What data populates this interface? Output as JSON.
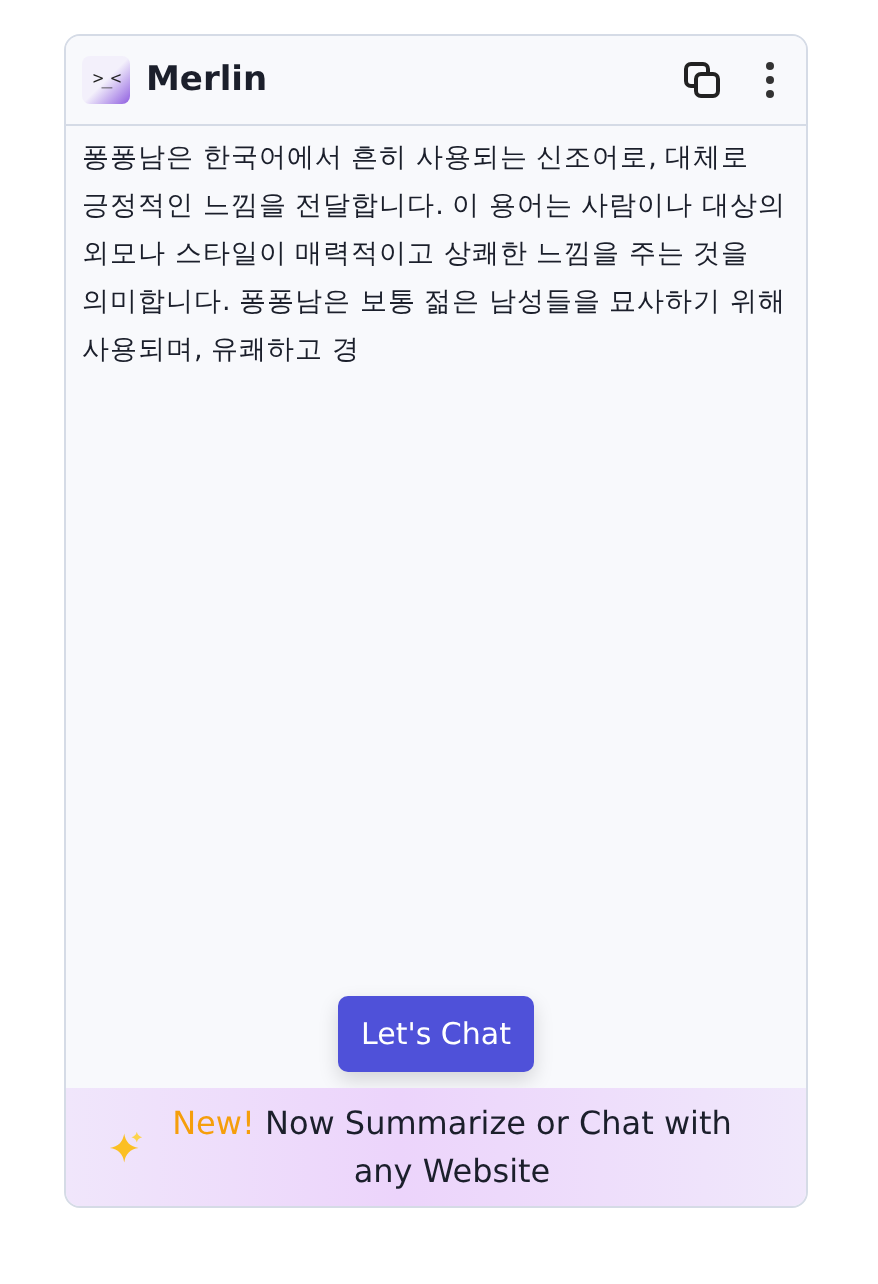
{
  "header": {
    "title": "Merlin",
    "logo": ">_<"
  },
  "message": "퐁퐁남은 한국어에서 흔히 사용되는 신조어로, 대체로 긍정적인 느낌을 전달합니다. 이 용어는 사람이나 대상의 외모나 스타일이 매력적이고 상쾌한 느낌을 주는 것을 의미합니다. 퐁퐁남은 보통 젊은 남성들을 묘사하기 위해 사용되며, 유쾌하고 경",
  "button": "Let's Chat",
  "banner": {
    "highlight": "New!",
    "text": "Now Summarize or Chat with any Website"
  }
}
